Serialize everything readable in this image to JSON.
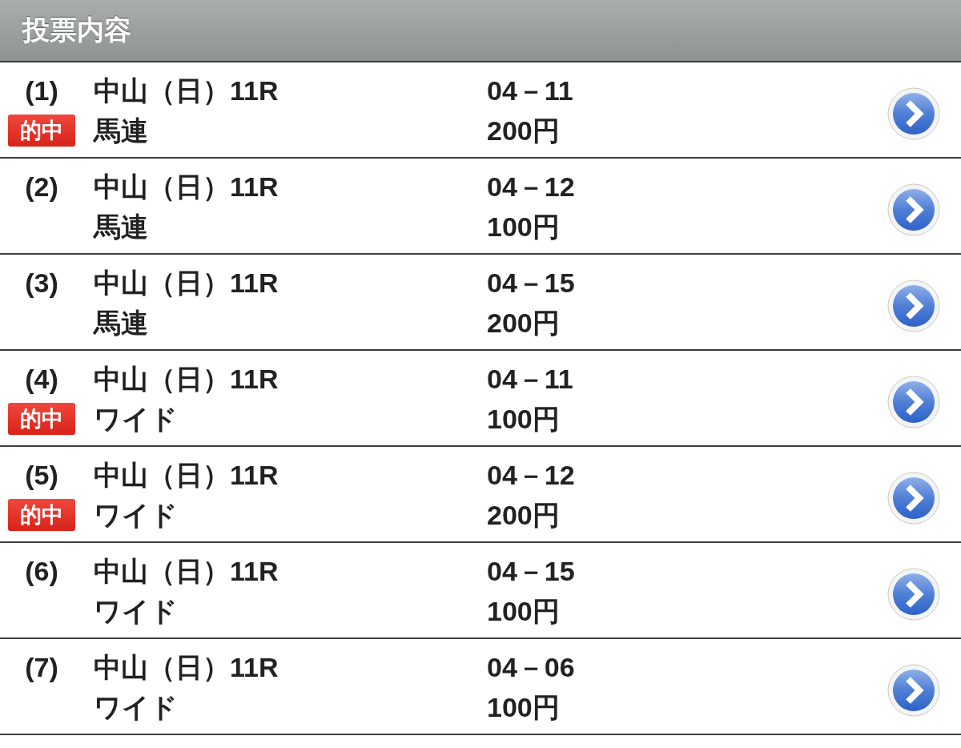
{
  "header": {
    "title": "投票内容"
  },
  "bets": [
    {
      "number": "(1)",
      "badge": "的中",
      "race": "中山（日）11R",
      "bet_type": "馬連",
      "combination": "04－11",
      "amount": "200円"
    },
    {
      "number": "(2)",
      "race": "中山（日）11R",
      "bet_type": "馬連",
      "combination": "04－12",
      "amount": "100円"
    },
    {
      "number": "(3)",
      "race": "中山（日）11R",
      "bet_type": "馬連",
      "combination": "04－15",
      "amount": "200円"
    },
    {
      "number": "(4)",
      "badge": "的中",
      "race": "中山（日）11R",
      "bet_type": "ワイド",
      "combination": "04－11",
      "amount": "100円"
    },
    {
      "number": "(5)",
      "badge": "的中",
      "race": "中山（日）11R",
      "bet_type": "ワイド",
      "combination": "04－12",
      "amount": "200円"
    },
    {
      "number": "(6)",
      "race": "中山（日）11R",
      "bet_type": "ワイド",
      "combination": "04－15",
      "amount": "100円"
    },
    {
      "number": "(7)",
      "race": "中山（日）11R",
      "bet_type": "ワイド",
      "combination": "04－06",
      "amount": "100円"
    }
  ]
}
